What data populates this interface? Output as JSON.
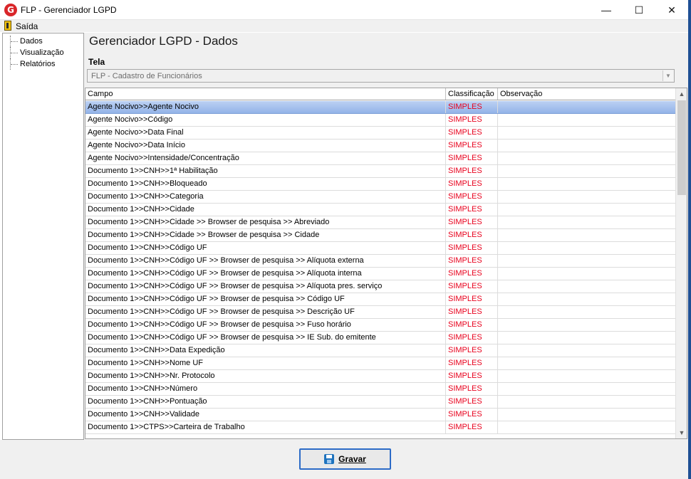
{
  "window": {
    "title": "FLP - Gerenciador LGPD",
    "icon": "app-logo-icon",
    "controls": {
      "minimize": "—",
      "maximize": "☐",
      "close": "✕"
    }
  },
  "menu": {
    "items": [
      {
        "label": "Saída",
        "icon": "exit-door-icon"
      }
    ]
  },
  "nav": {
    "items": [
      {
        "label": "Dados"
      },
      {
        "label": "Visualização"
      },
      {
        "label": "Relatórios"
      }
    ]
  },
  "main": {
    "heading": "Gerenciador LGPD - Dados",
    "tela_label": "Tela",
    "tela_value": "FLP - Cadastro de Funcionários"
  },
  "grid": {
    "columns": [
      "Campo",
      "Classificação",
      "Observação"
    ],
    "rows": [
      {
        "campo": "Agente Nocivo>>Agente Nocivo",
        "classificacao": "SIMPLES",
        "observacao": ""
      },
      {
        "campo": "Agente Nocivo>>Código",
        "classificacao": "SIMPLES",
        "observacao": ""
      },
      {
        "campo": "Agente Nocivo>>Data Final",
        "classificacao": "SIMPLES",
        "observacao": ""
      },
      {
        "campo": "Agente Nocivo>>Data Início",
        "classificacao": "SIMPLES",
        "observacao": ""
      },
      {
        "campo": "Agente Nocivo>>Intensidade/Concentração",
        "classificacao": "SIMPLES",
        "observacao": ""
      },
      {
        "campo": "Documento 1>>CNH>>1ª Habilitação",
        "classificacao": "SIMPLES",
        "observacao": ""
      },
      {
        "campo": "Documento 1>>CNH>>Bloqueado",
        "classificacao": "SIMPLES",
        "observacao": ""
      },
      {
        "campo": "Documento 1>>CNH>>Categoria",
        "classificacao": "SIMPLES",
        "observacao": ""
      },
      {
        "campo": "Documento 1>>CNH>>Cidade",
        "classificacao": "SIMPLES",
        "observacao": ""
      },
      {
        "campo": "Documento 1>>CNH>>Cidade >> Browser de pesquisa >> Abreviado",
        "classificacao": "SIMPLES",
        "observacao": ""
      },
      {
        "campo": "Documento 1>>CNH>>Cidade >> Browser de pesquisa >> Cidade",
        "classificacao": "SIMPLES",
        "observacao": ""
      },
      {
        "campo": "Documento 1>>CNH>>Código UF",
        "classificacao": "SIMPLES",
        "observacao": ""
      },
      {
        "campo": "Documento 1>>CNH>>Código UF >> Browser de pesquisa >> Alíquota externa",
        "classificacao": "SIMPLES",
        "observacao": ""
      },
      {
        "campo": "Documento 1>>CNH>>Código UF >> Browser de pesquisa >> Alíquota interna",
        "classificacao": "SIMPLES",
        "observacao": ""
      },
      {
        "campo": "Documento 1>>CNH>>Código UF >> Browser de pesquisa >> Alíquota pres. serviço",
        "classificacao": "SIMPLES",
        "observacao": ""
      },
      {
        "campo": "Documento 1>>CNH>>Código UF >> Browser de pesquisa >> Código UF",
        "classificacao": "SIMPLES",
        "observacao": ""
      },
      {
        "campo": "Documento 1>>CNH>>Código UF >> Browser de pesquisa >> Descrição UF",
        "classificacao": "SIMPLES",
        "observacao": ""
      },
      {
        "campo": "Documento 1>>CNH>>Código UF >> Browser de pesquisa >> Fuso horário",
        "classificacao": "SIMPLES",
        "observacao": ""
      },
      {
        "campo": "Documento 1>>CNH>>Código UF >> Browser de pesquisa >> IE Sub. do emitente",
        "classificacao": "SIMPLES",
        "observacao": ""
      },
      {
        "campo": "Documento 1>>CNH>>Data Expedição",
        "classificacao": "SIMPLES",
        "observacao": ""
      },
      {
        "campo": "Documento 1>>CNH>>Nome UF",
        "classificacao": "SIMPLES",
        "observacao": ""
      },
      {
        "campo": "Documento 1>>CNH>>Nr. Protocolo",
        "classificacao": "SIMPLES",
        "observacao": ""
      },
      {
        "campo": "Documento 1>>CNH>>Número",
        "classificacao": "SIMPLES",
        "observacao": ""
      },
      {
        "campo": "Documento 1>>CNH>>Pontuação",
        "classificacao": "SIMPLES",
        "observacao": ""
      },
      {
        "campo": "Documento 1>>CNH>>Validade",
        "classificacao": "SIMPLES",
        "observacao": ""
      },
      {
        "campo": "Documento 1>>CTPS>>Carteira de Trabalho",
        "classificacao": "SIMPLES",
        "observacao": ""
      }
    ],
    "selected_row": 0
  },
  "footer": {
    "save_label": "Gravar",
    "save_icon": "floppy-disk-icon"
  },
  "colors": {
    "classification_text": "#e8001c",
    "selection": "#93b3e8",
    "accent_border": "#2c6bc7"
  }
}
